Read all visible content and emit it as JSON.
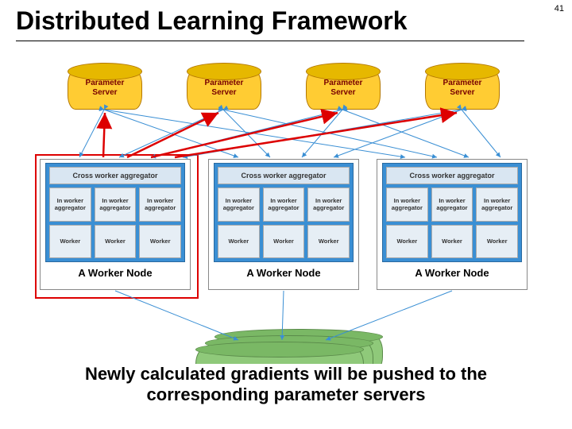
{
  "page_number": "41",
  "title": "Distributed Learning Framework",
  "parameter_server_label": "Parameter\nServer",
  "cross_worker_label": "Cross worker aggregator",
  "in_worker_label": "In worker aggregator",
  "worker_label": "Worker",
  "worker_node_caption": "A Worker Node",
  "bottom_caption": "Newly calculated gradients will be pushed to the corresponding parameter servers",
  "colors": {
    "param_server_fill": "#ffcc33",
    "worker_inner_fill": "#3a8fd4",
    "highlight": "#d00",
    "datastore_fill": "#8fc97a"
  },
  "layout": {
    "param_server_count": 4,
    "worker_node_count": 3,
    "sub_workers_per_node": 3
  }
}
